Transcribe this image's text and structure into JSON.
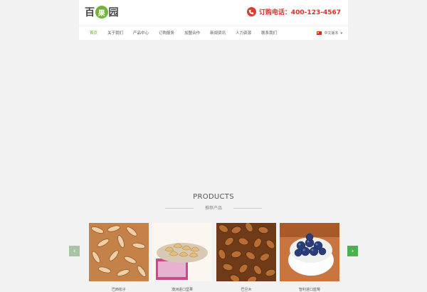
{
  "header": {
    "logo": {
      "part1": "百",
      "leaf": "果",
      "part2": "园"
    },
    "phone_text": "订购电话：400-123-4567"
  },
  "nav": {
    "items": [
      "首页",
      "关于我们",
      "产品中心",
      "订购服务",
      "加盟合作",
      "新闻资讯",
      "人力资源",
      "联系我们"
    ],
    "active_index": 0,
    "language": "中文版本"
  },
  "products": {
    "title": "PRODUCTS",
    "subtitle": "推荐产品",
    "items": [
      {
        "label": "巴西松子"
      },
      {
        "label": "澳洲进口坚果"
      },
      {
        "label": "巴旦木"
      },
      {
        "label": "智利进口蓝莓"
      }
    ]
  },
  "colors": {
    "accent": "#6aaa2f",
    "phone": "#d6322a",
    "next_arrow": "#4caf50"
  },
  "icons": {
    "phone": "phone-icon",
    "prev": "arrow-left-icon",
    "next": "arrow-right-icon",
    "lang": "flag-icon"
  }
}
